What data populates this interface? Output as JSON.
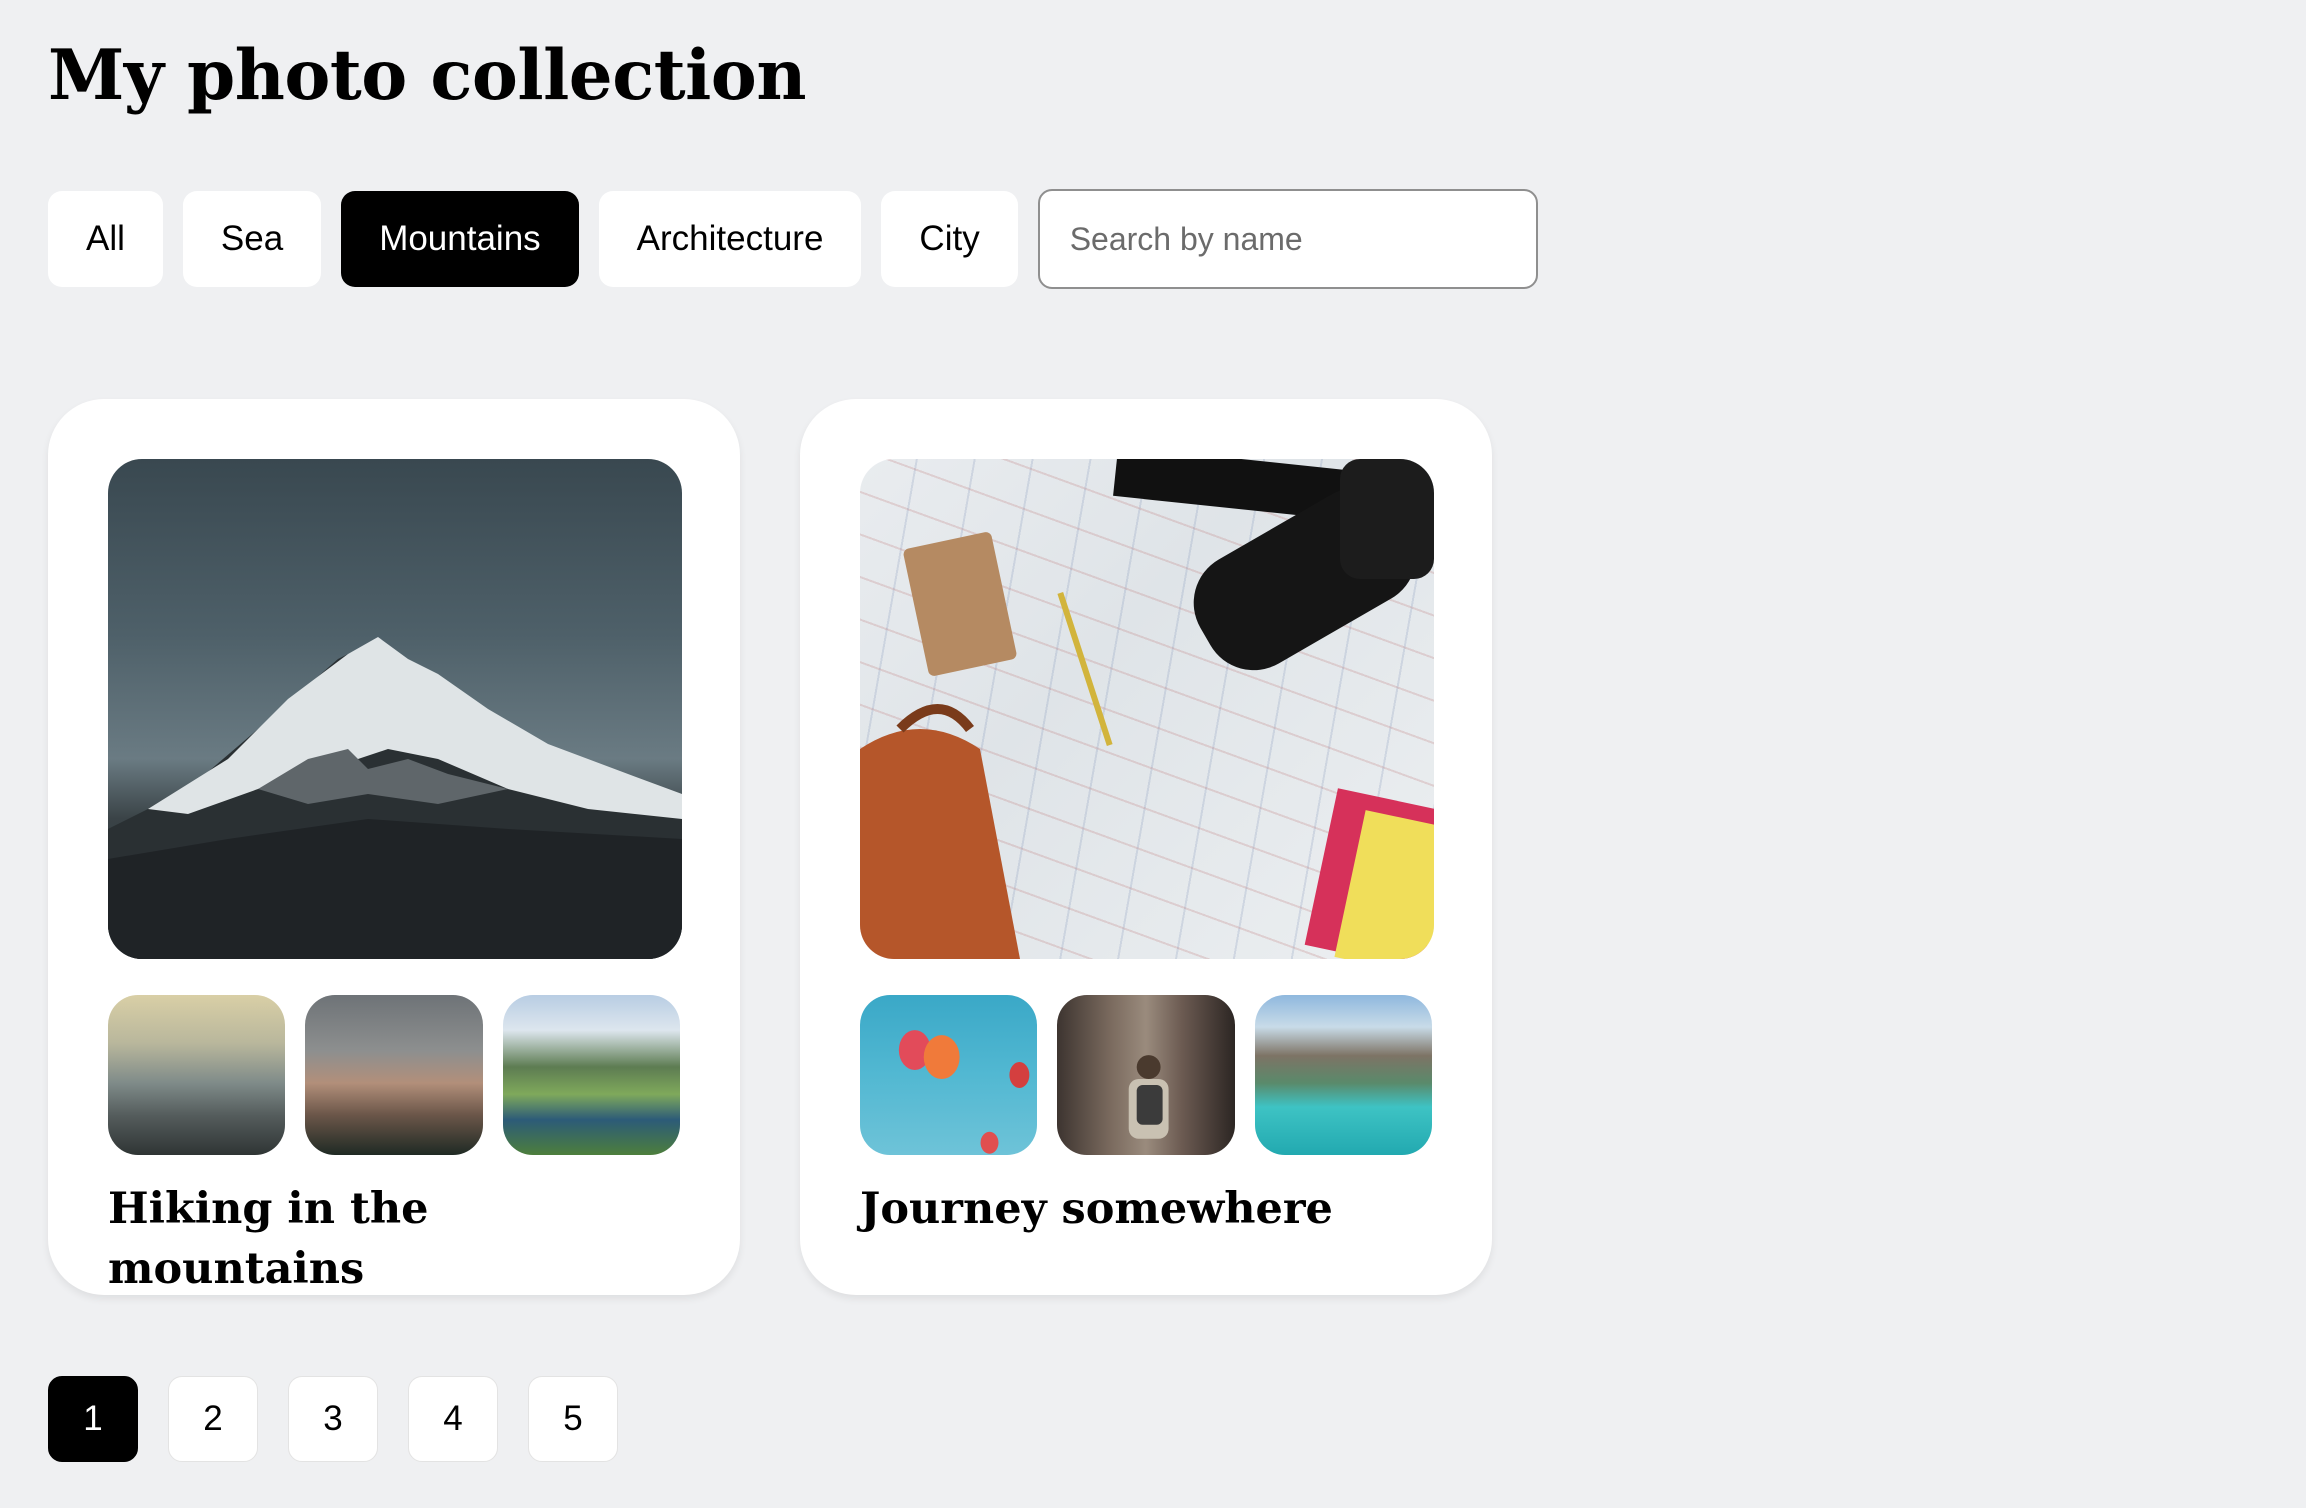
{
  "page": {
    "title": "My photo collection"
  },
  "filters": {
    "chips": [
      {
        "label": "All",
        "active": false
      },
      {
        "label": "Sea",
        "active": false
      },
      {
        "label": "Mountains",
        "active": true
      },
      {
        "label": "Architecture",
        "active": false
      },
      {
        "label": "City",
        "active": false
      }
    ],
    "search_placeholder": "Search by name",
    "search_value": ""
  },
  "cards": [
    {
      "title": "Hiking in the mountains",
      "main_photo": "snowy-mountain-peak",
      "thumbnails": [
        "misty-mountain-ridges",
        "rocky-mountain-peaks",
        "alpine-lake-valley"
      ]
    },
    {
      "title": "Journey somewhere",
      "main_photo": "travel-map-with-camera",
      "thumbnails": [
        "hot-air-balloons",
        "traveler-in-alley",
        "turquoise-lake-boat"
      ]
    }
  ],
  "pagination": {
    "pages": [
      "1",
      "2",
      "3",
      "4",
      "5"
    ],
    "current": "1"
  },
  "colors": {
    "background": "#eff0f2",
    "card": "#ffffff",
    "active_chip": "#000000",
    "active_chip_text": "#ffffff"
  }
}
